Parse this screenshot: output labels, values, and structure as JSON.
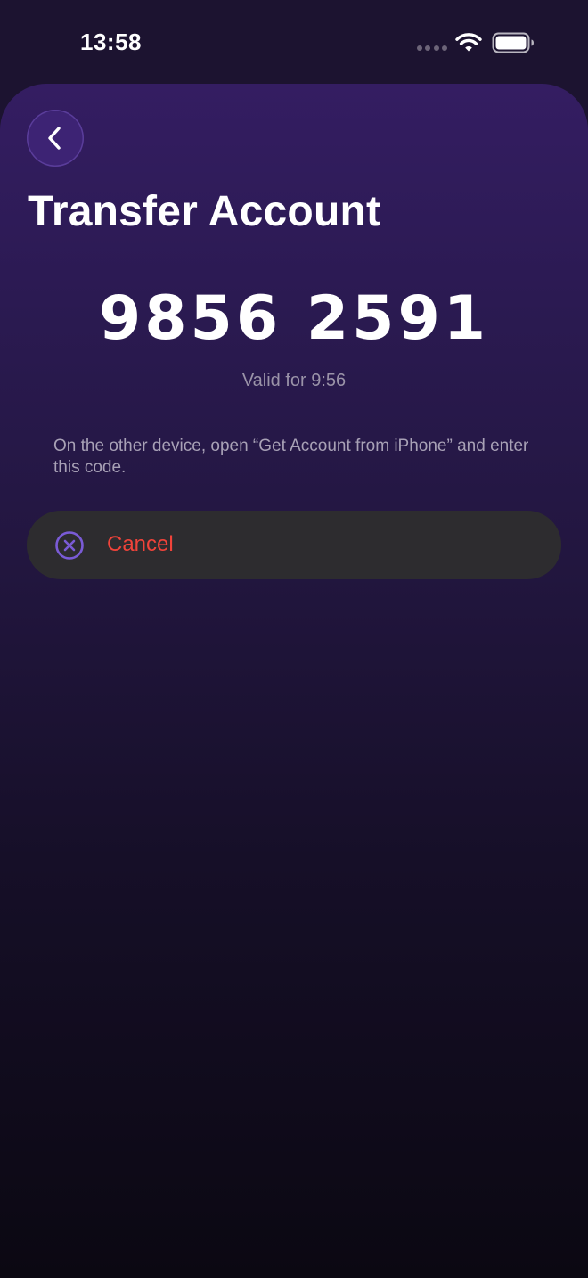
{
  "status_bar": {
    "time": "13:58",
    "icons": [
      "signal-dots-icon",
      "wifi-icon",
      "battery-icon"
    ]
  },
  "header": {
    "back_icon": "chevron-left-icon",
    "title": "Transfer Account"
  },
  "transfer": {
    "code": "9856 2591",
    "validity": "Valid for 9:56",
    "instructions": "On the other device, open “Get Account from iPhone” and enter this code."
  },
  "actions": {
    "cancel_label": "Cancel",
    "cancel_icon": "close-circle-icon"
  },
  "colors": {
    "background_top": "#341d62",
    "background_bottom": "#0b0812",
    "accent_purple": "#7a5bd6",
    "cancel_text": "#f0433a",
    "button_background": "#2d2c2f"
  }
}
